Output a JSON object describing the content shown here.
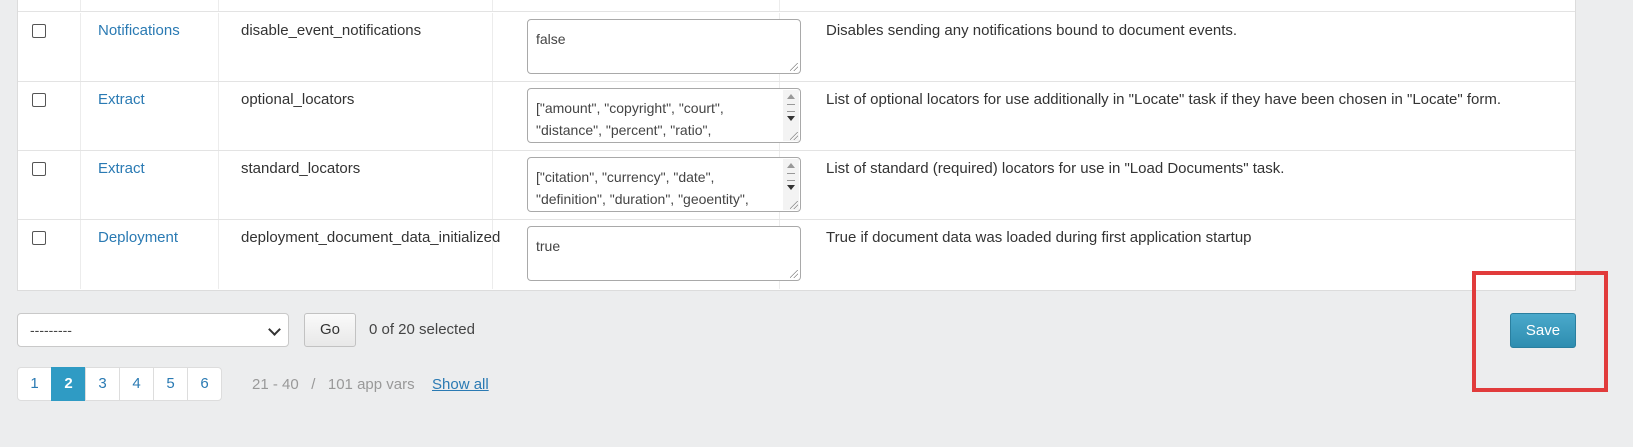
{
  "rows": [
    {
      "category": "Notifications",
      "name": "disable_event_notifications",
      "value": "false",
      "description": "Disables sending any notifications bound to document events."
    },
    {
      "category": "Extract",
      "name": "optional_locators",
      "value": "[\"amount\", \"copyright\", \"court\",\n\"distance\", \"percent\", \"ratio\",",
      "description": "List of optional locators for use additionally in \"Locate\" task if they have been chosen in \"Locate\" form."
    },
    {
      "category": "Extract",
      "name": "standard_locators",
      "value": "[\"citation\", \"currency\", \"date\",\n\"definition\", \"duration\", \"geoentity\",",
      "description": "List of standard (required) locators for use in \"Load Documents\" task."
    },
    {
      "category": "Deployment",
      "name": "deployment_document_data_initialized",
      "value": "true",
      "description": "True if document data was loaded during first application startup"
    }
  ],
  "actions": {
    "select_value": "---------",
    "go_label": "Go",
    "selection_count": "0 of 20 selected",
    "save_label": "Save"
  },
  "pagination": {
    "pages": [
      "1",
      "2",
      "3",
      "4",
      "5",
      "6"
    ],
    "current": "2",
    "range": "21 - 40   /   101 app vars",
    "show_all": "Show all"
  },
  "colors": {
    "link": "#2a7ab3",
    "primary_button": "#2f9bc4",
    "highlight": "#e13b3b"
  }
}
